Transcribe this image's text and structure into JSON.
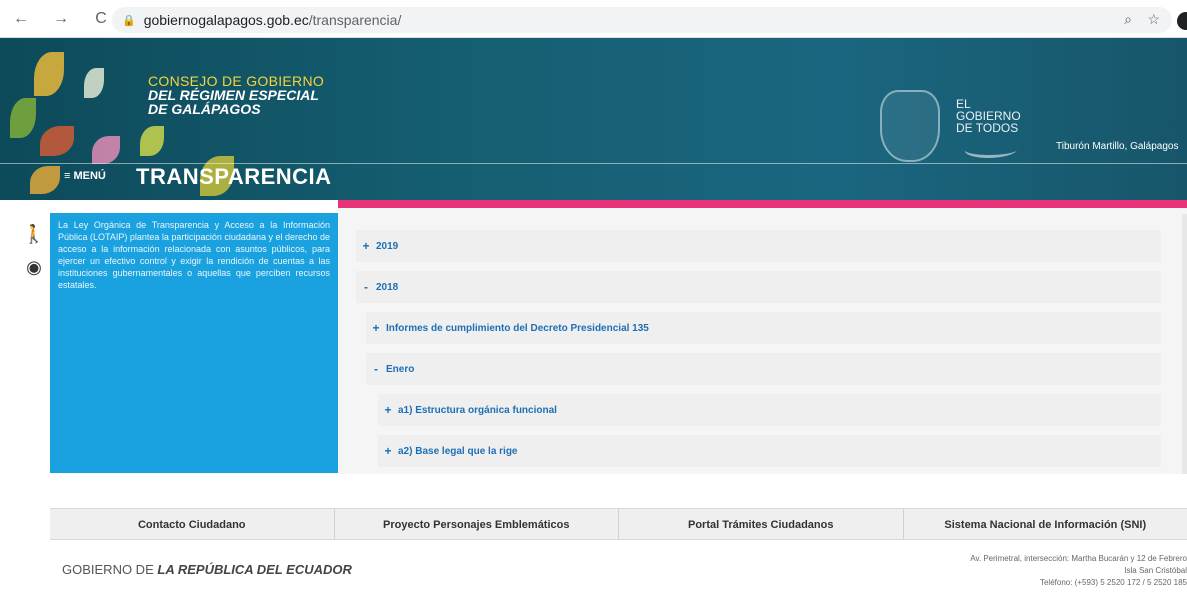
{
  "browser": {
    "url_domain": "gobiernogalapagos.gob.ec",
    "url_path": "/transparencia/"
  },
  "header": {
    "org_line1": "CONSEJO DE GOBIERNO",
    "org_line2": "DEL RÉGIMEN ESPECIAL",
    "org_line3": "DE GALÁPAGOS",
    "menu_label": "≡ MENÚ",
    "section_title": "TRANSPARENCIA",
    "gob_line1": "EL",
    "gob_line2": "GOBIERNO",
    "gob_line3": "DE TODOS",
    "photo_caption": "Tiburón Martillo, Galápagos"
  },
  "sidebar": {
    "intro": "La Ley Orgánica de Transparencia y Acceso a la Información Pública (LOTAIP) plantea la participación ciudadana y el derecho de acceso a la información relacionada con asuntos públicos, para ejercer un efectivo control y exigir la rendición de cuentas a las instituciones gubernamentales o aquellas que perciben recursos estatales."
  },
  "accordion": [
    {
      "sign": "+",
      "label": "2019"
    },
    {
      "sign": "-",
      "label": "2018"
    },
    {
      "sign": "+",
      "label": "Informes de cumplimiento del Decreto Presidencial 135"
    },
    {
      "sign": "-",
      "label": "Enero"
    },
    {
      "sign": "+",
      "label": "a1) Estructura orgánica funcional"
    },
    {
      "sign": "+",
      "label": "a2) Base legal que la rige"
    }
  ],
  "footer": {
    "links": [
      "Contacto Ciudadano",
      "Proyecto Personajes Emblemáticos",
      "Portal Trámites Ciudadanos",
      "Sistema Nacional de Información (SNI)"
    ],
    "gov_prefix": "GOBIERNO DE",
    "gov_name": "LA REPÚBLICA DEL ECUADOR",
    "address_line1": "Av. Perimetral, intersección: Martha Bucarán y 12 de Febrero",
    "address_line2": "Isla San Cristóbal",
    "address_line3": "Teléfono: (+593) 5 2520 172 / 5 2520 185"
  }
}
